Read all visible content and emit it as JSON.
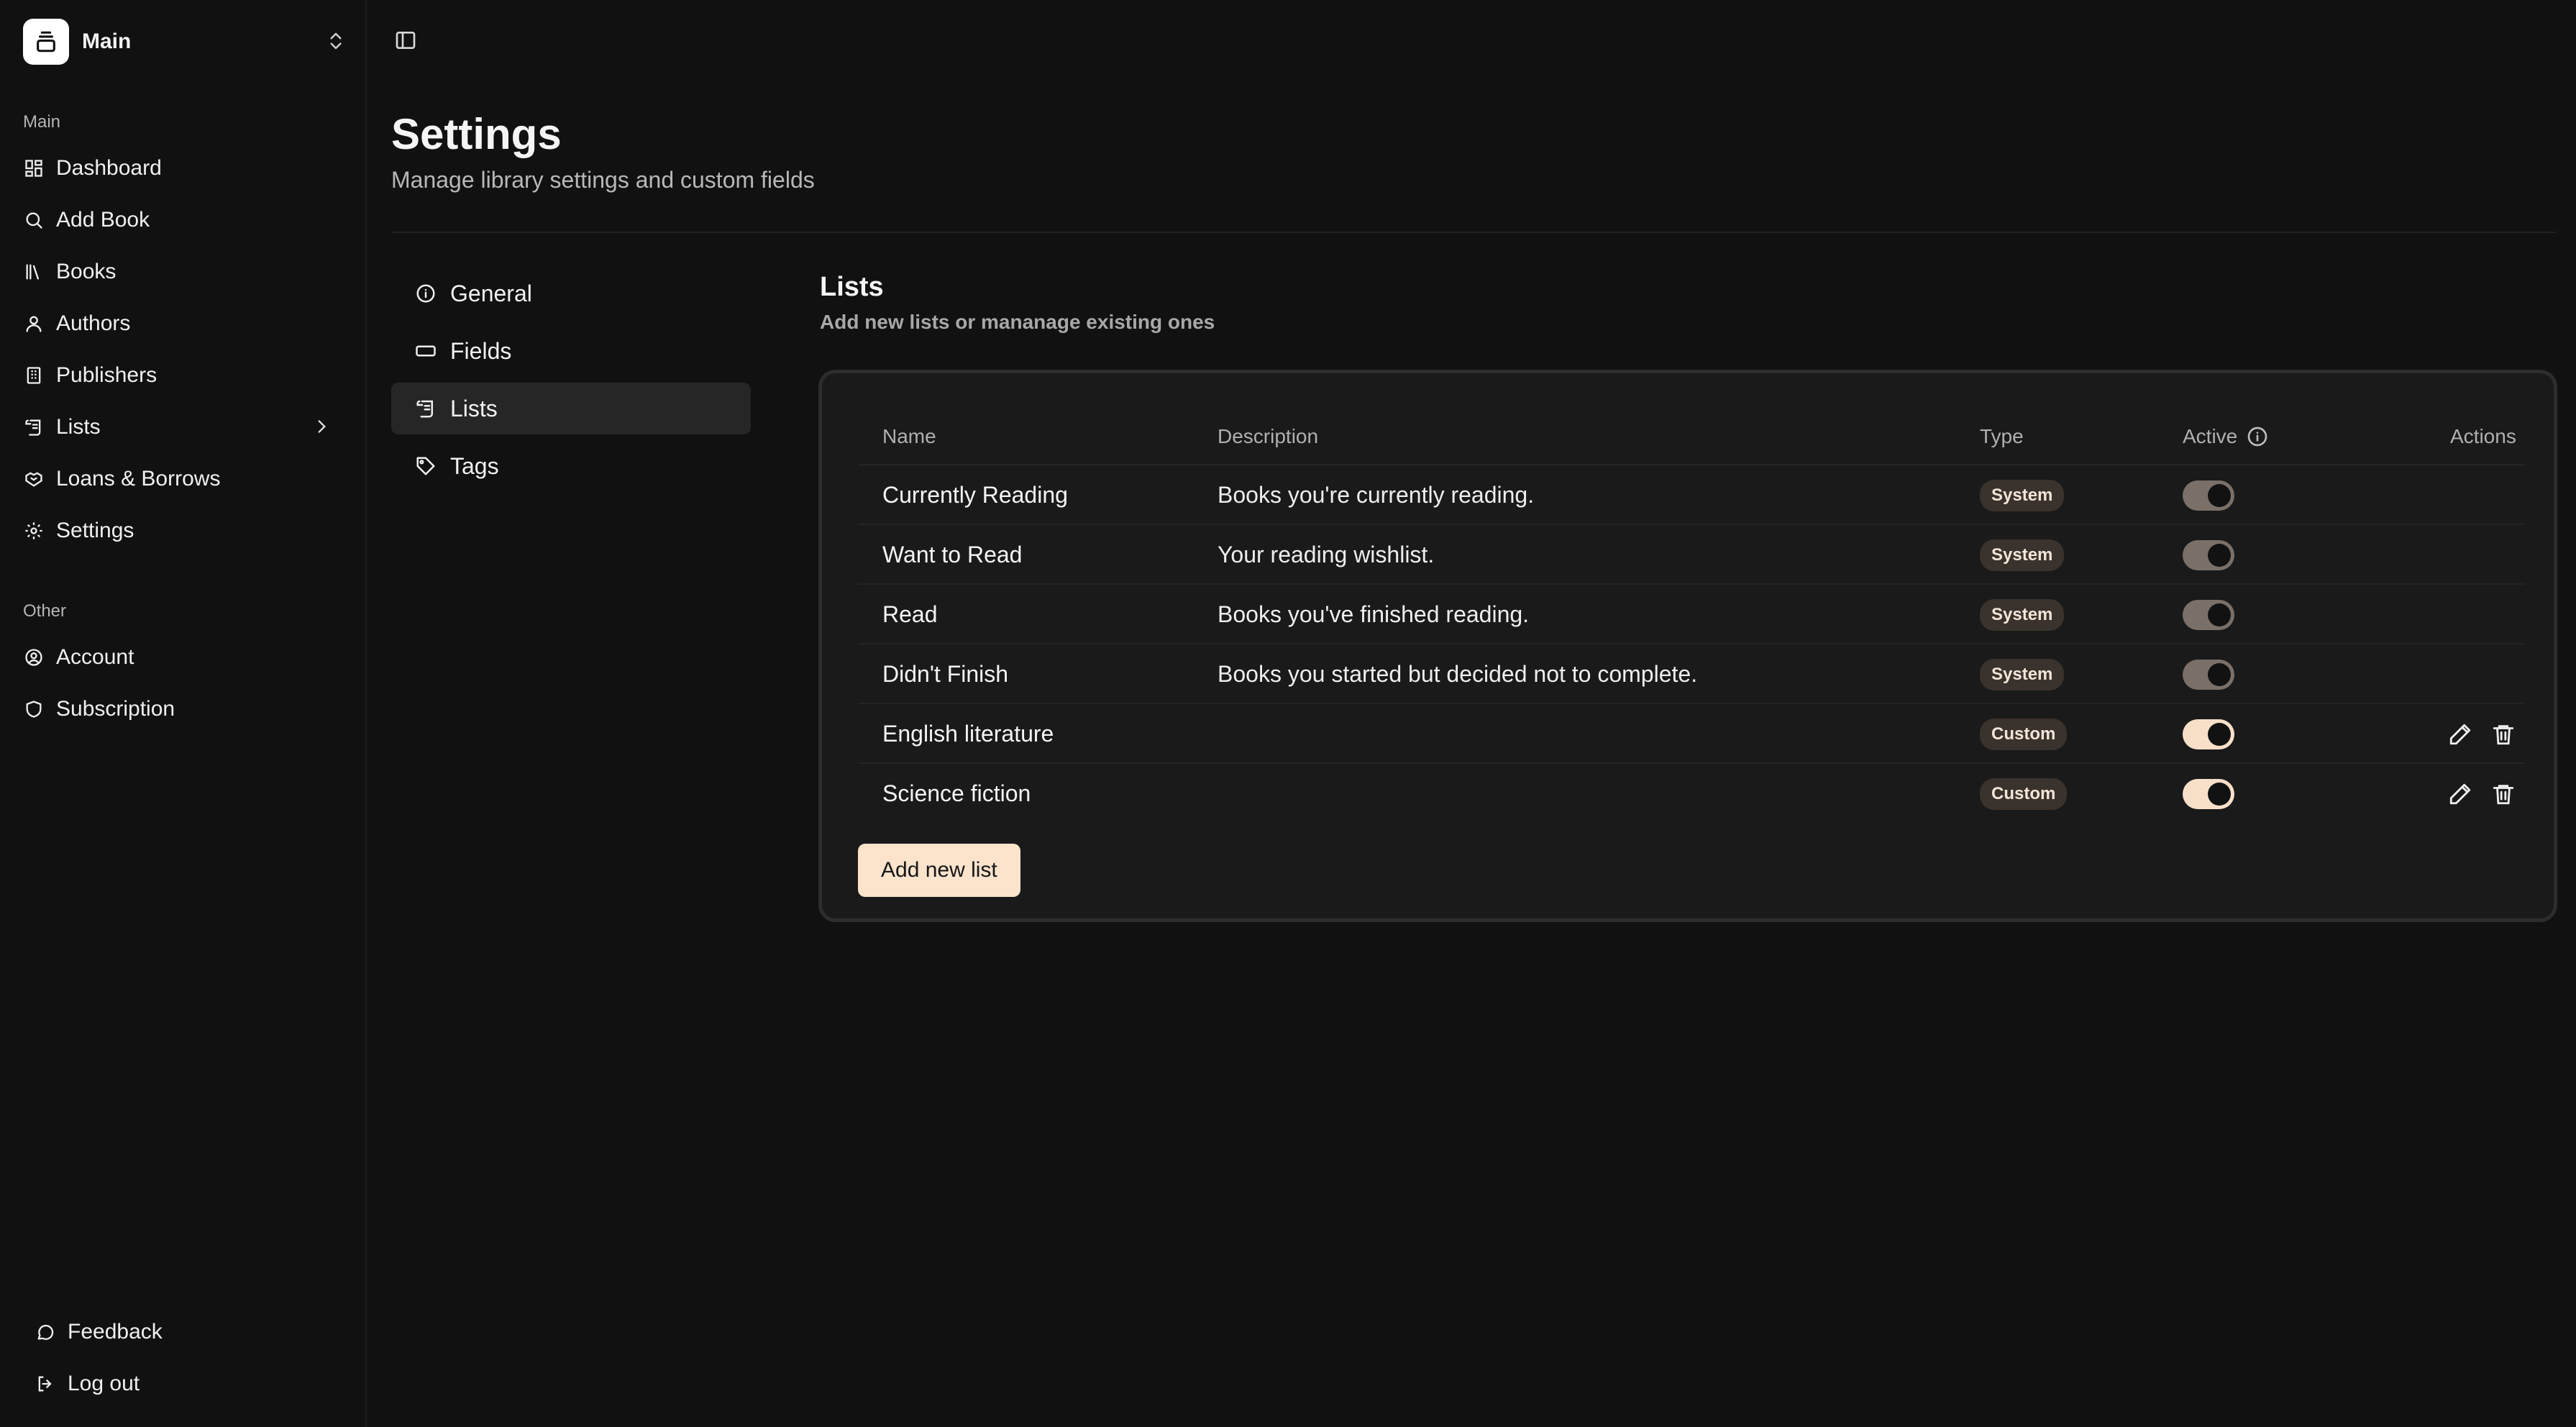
{
  "workspace": {
    "name": "Main"
  },
  "sidebar": {
    "main_label": "Main",
    "main_items": [
      {
        "label": "Dashboard",
        "icon": "dashboard-icon"
      },
      {
        "label": "Add Book",
        "icon": "search-icon"
      },
      {
        "label": "Books",
        "icon": "books-icon"
      },
      {
        "label": "Authors",
        "icon": "user-icon"
      },
      {
        "label": "Publishers",
        "icon": "building-icon"
      },
      {
        "label": "Lists",
        "icon": "scroll-icon"
      },
      {
        "label": "Loans & Borrows",
        "icon": "handshake-icon"
      },
      {
        "label": "Settings",
        "icon": "gear-icon"
      }
    ],
    "other_label": "Other",
    "other_items": [
      {
        "label": "Account",
        "icon": "user-circle-icon"
      },
      {
        "label": "Subscription",
        "icon": "shield-icon"
      }
    ],
    "footer_items": [
      {
        "label": "Feedback",
        "icon": "chat-icon"
      },
      {
        "label": "Log out",
        "icon": "logout-icon"
      }
    ]
  },
  "page": {
    "title": "Settings",
    "subtitle": "Manage library settings and custom fields"
  },
  "settings_nav": [
    {
      "label": "General",
      "icon": "info-icon",
      "active": false
    },
    {
      "label": "Fields",
      "icon": "field-icon",
      "active": false
    },
    {
      "label": "Lists",
      "icon": "scroll-icon",
      "active": true
    },
    {
      "label": "Tags",
      "icon": "tag-icon",
      "active": false
    }
  ],
  "lists_section": {
    "title": "Lists",
    "description": "Add new lists or mananage existing ones",
    "columns": {
      "name": "Name",
      "description": "Description",
      "type": "Type",
      "active": "Active",
      "actions": "Actions"
    },
    "rows": [
      {
        "name": "Currently Reading",
        "description": "Books you're currently reading.",
        "type": "System",
        "active": false,
        "editable": false
      },
      {
        "name": "Want to Read",
        "description": "Your reading wishlist.",
        "type": "System",
        "active": false,
        "editable": false
      },
      {
        "name": "Read",
        "description": "Books you've finished reading.",
        "type": "System",
        "active": false,
        "editable": false
      },
      {
        "name": "Didn't Finish",
        "description": "Books you started but decided not to complete.",
        "type": "System",
        "active": false,
        "editable": false
      },
      {
        "name": "English literature",
        "description": "",
        "type": "Custom",
        "active": true,
        "editable": true
      },
      {
        "name": "Science fiction",
        "description": "",
        "type": "Custom",
        "active": true,
        "editable": true
      }
    ],
    "add_button": "Add new list"
  },
  "colors": {
    "background": "#111111",
    "accent": "#fbe3cc",
    "badge_bg": "#3a322c",
    "toggle_on": "#f8dfc8",
    "toggle_off": "#7a7068"
  }
}
